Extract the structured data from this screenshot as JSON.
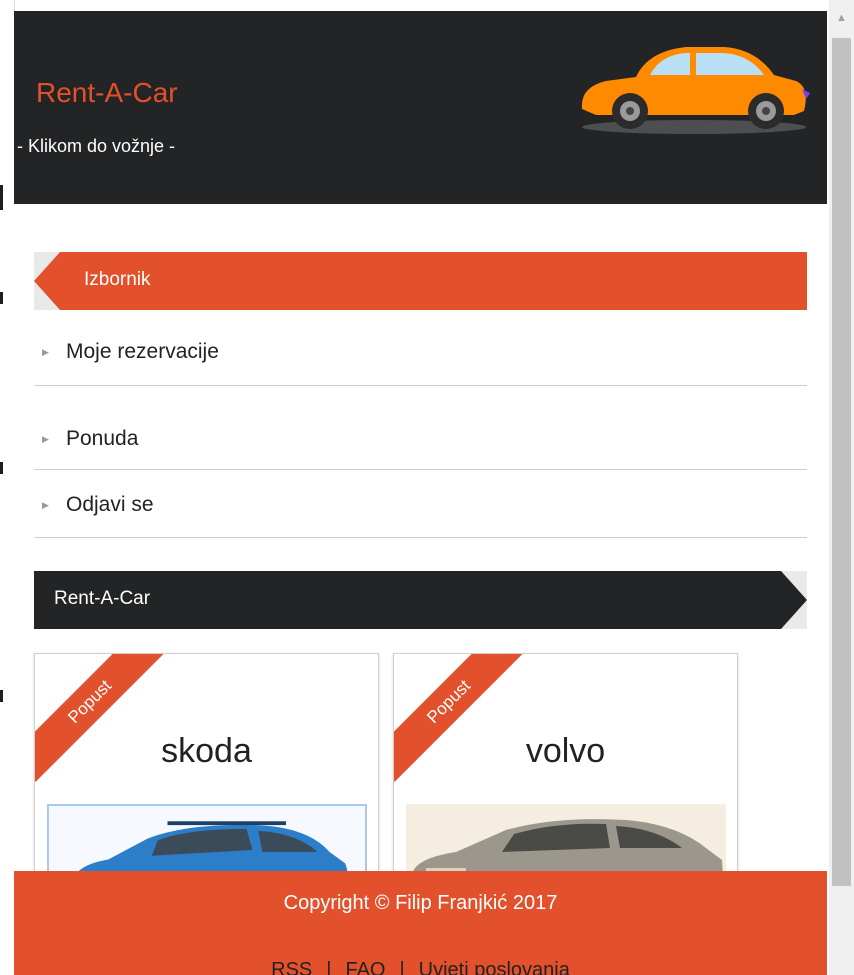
{
  "site": {
    "brand": "Rent-A-Car",
    "tagline": "- Klikom do vožnje -"
  },
  "menu": {
    "title": "Izbornik",
    "items": [
      {
        "label": "Moje rezervacije"
      },
      {
        "label": "Ponuda"
      },
      {
        "label": "Odjavi se"
      }
    ]
  },
  "section": {
    "title": "Rent-A-Car"
  },
  "cards": [
    {
      "badge": "Popust",
      "name": "skoda",
      "image_icon": "blue-car-icon"
    },
    {
      "badge": "Popust",
      "name": "volvo",
      "image_icon": "silver-car-icon"
    }
  ],
  "footer": {
    "copyright": "Copyright © Filip Franjkić 2017",
    "links": [
      "RSS",
      "FAQ",
      "Uvjeti poslovanja"
    ],
    "separator": "|"
  },
  "colors": {
    "accent": "#e2512c",
    "header_bg": "#222426",
    "card_border": "#d0d0d0"
  }
}
